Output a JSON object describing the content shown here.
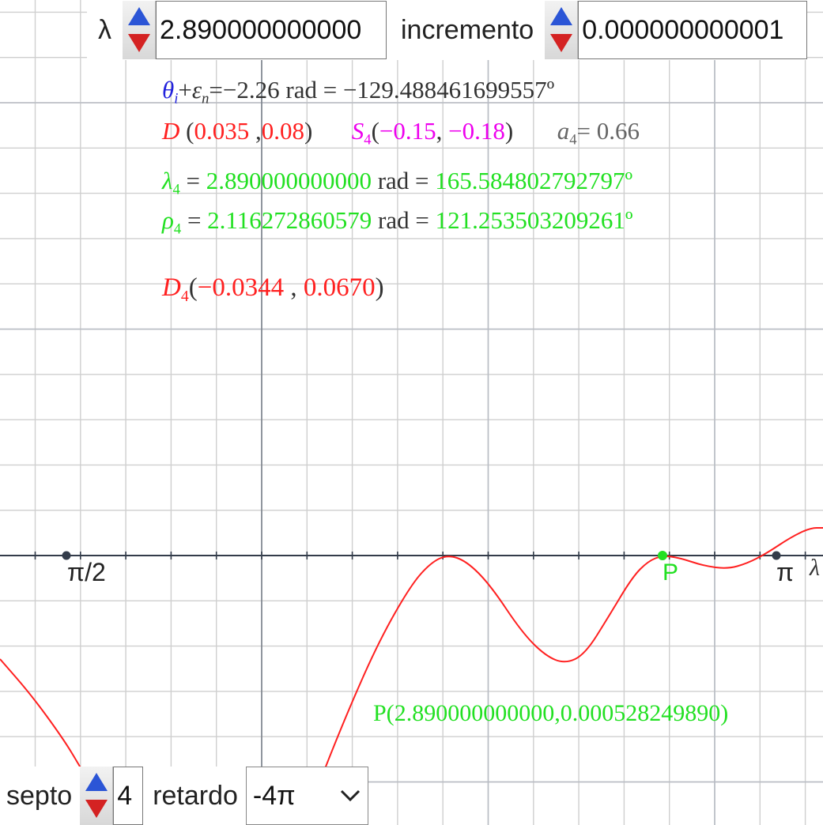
{
  "top_controls": {
    "lambda_label": "λ",
    "lambda_value": "2.890000000000",
    "increment_label": "incremento",
    "increment_value": "0.000000000001"
  },
  "info": {
    "line1": {
      "theta": "θ",
      "theta_sub": "i",
      "plus": "+",
      "eps": "ε",
      "eps_sub": "n",
      "rest": "=−2.26 rad = −129.488461699557º"
    },
    "line2": {
      "d": "D",
      "d_open": " (",
      "dx": "0.035",
      "d_comma": " ,",
      "dy": "0.08",
      "d_close": ")",
      "s": "S",
      "s_sub": "4",
      "s_open": "(",
      "sx": "−0.15",
      "s_comma": ", ",
      "sy": "−0.18",
      "s_close": ")",
      "a": "a",
      "a_sub": "4",
      "a_val": "= 0.66"
    },
    "line3": {
      "sym": "λ",
      "sub": "4",
      "eq": " = ",
      "rad": "2.890000000000",
      "mid": " rad = ",
      "deg": "165.584802792797º"
    },
    "line4": {
      "sym": "ρ",
      "sub": "4",
      "eq": " = ",
      "rad": "2.116272860579",
      "mid": " rad = ",
      "deg": "121.253503209261º"
    },
    "line5": {
      "d": "D",
      "sub": "4",
      "open": "(",
      "x": "−0.0344",
      "sep": " , ",
      "y": "0.0670",
      "close": ")"
    }
  },
  "graph": {
    "tick_half_pi": "π/2",
    "tick_pi": "π",
    "axis_label": "λ",
    "point_label": "P",
    "p_readout": {
      "prefix": "P(",
      "x": "2.890000000000",
      "comma": ",",
      "y": "0.000528249890",
      "close": ")"
    }
  },
  "bottom_controls": {
    "septo_label": "septo",
    "septo_value": "4",
    "retardo_label": "retardo",
    "retardo_value": "-4π"
  },
  "colors": {
    "curve": "#ff2020",
    "point": "#22e022",
    "axis": "#333c4a",
    "grid": "#cfcfcf"
  },
  "icons": [
    "spinner-up-icon",
    "spinner-down-icon",
    "chevron-down-icon"
  ]
}
